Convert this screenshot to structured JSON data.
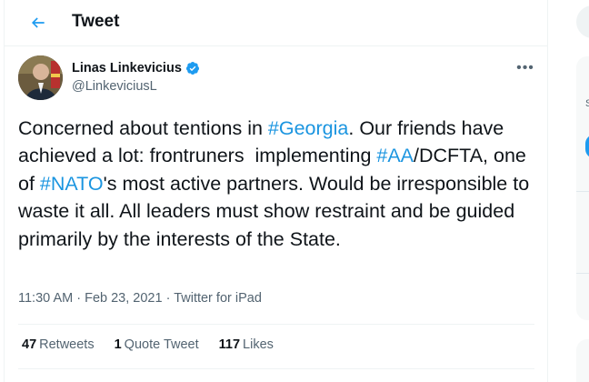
{
  "header": {
    "title": "Tweet",
    "back_icon": "arrow-left-icon",
    "accent_color": "#1d9bf0"
  },
  "author": {
    "name": "Linas Linkevicius",
    "handle": "@LinkeviciusL",
    "verified_icon": "verified-badge-icon"
  },
  "more_icon": "more-horizontal-icon",
  "tweet": {
    "segments": [
      {
        "text": "Concerned about tentions in ",
        "hashtag": false
      },
      {
        "text": "#Georgia",
        "hashtag": true
      },
      {
        "text": ". Our friends have achieved a lot: frontruners  implementing ",
        "hashtag": false
      },
      {
        "text": "#AA",
        "hashtag": true
      },
      {
        "text": "/DCFTA, one of ",
        "hashtag": false
      },
      {
        "text": "#NATO",
        "hashtag": true
      },
      {
        "text": "'s most active partners. Would be irresponsible to waste it all. All leaders must show restraint and be guided primarily by the interests of the State.",
        "hashtag": false
      }
    ]
  },
  "meta": {
    "time": "11:30 AM",
    "separator": " · ",
    "date": "Feb 23, 2021",
    "source": "Twitter for iPad"
  },
  "stats": {
    "retweets_count": "47",
    "retweets_label": "Retweets",
    "quotes_count": "1",
    "quotes_label": "Quote Tweet",
    "likes_count": "117",
    "likes_label": "Likes"
  },
  "sidebar": {
    "partial_letter": "S"
  }
}
